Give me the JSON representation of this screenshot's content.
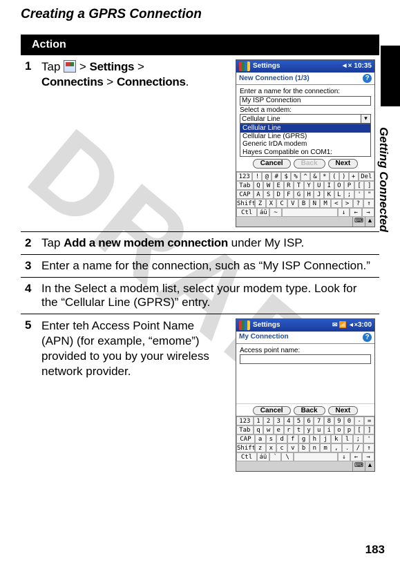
{
  "heading": "Creating a GPRS Connection",
  "action_label": "Action",
  "side_label": "Getting Connected",
  "page_number": "183",
  "watermark": "DRAFT",
  "steps": {
    "s1": {
      "num": "1",
      "pre": "Tap ",
      "settings": "Settings",
      "sep1": " > ",
      "connectins": "Connectins",
      "sep2": " > ",
      "connections": "Connections",
      "post": "."
    },
    "s2": {
      "num": "2",
      "pre": "Tap ",
      "bold": "Add a new modem connection",
      "post": " under My ISP."
    },
    "s3": {
      "num": "3",
      "text": "Enter a name for the connection, such as “My ISP Connection.”"
    },
    "s4": {
      "num": "4",
      "text": "In the Select a modem list, select your modem type. Look for the “Cellular Line (GPRS)” entry."
    },
    "s5": {
      "num": "5",
      "text": "Enter teh Access Point Name (APN) (for example, “emome”) provided to you by your wireless network provider."
    }
  },
  "mock1": {
    "top_title": "Settings",
    "time": "10:35",
    "subtitle": "New Connection (1/3)",
    "lbl_name": "Enter a name for the connection:",
    "val_name": "My ISP Connection",
    "lbl_modem": "Select a modem:",
    "modem_options": {
      "a": "Cellular Line",
      "b": "Cellular Line",
      "c": "Cellular Line (GPRS)",
      "d": "Generic IrDA modem",
      "e": "Hayes Compatible on COM1:"
    },
    "btn_cancel": "Cancel",
    "btn_back": "Back",
    "btn_next": "Next",
    "kbd": {
      "r1": {
        "a": "123",
        "b": "!",
        "c": "@",
        "d": "#",
        "e": "$",
        "f": "%",
        "g": "^",
        "h": "&",
        "i": "*",
        "j": "(",
        "k": ")",
        "l": "+",
        "m": "Del"
      },
      "r2": {
        "a": "Tab",
        "b": "Q",
        "c": "W",
        "d": "E",
        "e": "R",
        "f": "T",
        "g": "Y",
        "h": "U",
        "i": "I",
        "j": "O",
        "k": "P",
        "l": "[",
        "m": "]"
      },
      "r3": {
        "a": "CAP",
        "b": "A",
        "c": "S",
        "d": "D",
        "e": "F",
        "f": "G",
        "g": "H",
        "h": "J",
        "i": "K",
        "j": "L",
        "k": ";",
        "l": "'",
        "m": "\""
      },
      "r4": {
        "a": "Shift",
        "b": "Z",
        "c": "X",
        "d": "C",
        "e": "V",
        "f": "B",
        "g": "N",
        "h": "M",
        "i": "<",
        "j": ">",
        "k": "?",
        "l": "↑"
      },
      "r5": {
        "a": "Ctl",
        "b": "áü",
        "c": "~",
        "d": " ",
        "e": "↓",
        "f": "←",
        "g": "→"
      }
    }
  },
  "mock2": {
    "top_title": "Settings",
    "time": "3:00",
    "subtitle": "My Connection",
    "lbl_apn": "Access point name:",
    "btn_cancel": "Cancel",
    "btn_back": "Back",
    "btn_next": "Next",
    "kbd": {
      "r1": {
        "a": "123",
        "b": "1",
        "c": "2",
        "d": "3",
        "e": "4",
        "f": "5",
        "g": "6",
        "h": "7",
        "i": "8",
        "j": "9",
        "k": "0",
        "l": "-",
        "m": "="
      },
      "r2": {
        "a": "Tab",
        "b": "q",
        "c": "w",
        "d": "e",
        "e": "r",
        "f": "t",
        "g": "y",
        "h": "u",
        "i": "i",
        "j": "o",
        "k": "p",
        "l": "[",
        "m": "]"
      },
      "r3": {
        "a": "CAP",
        "b": "a",
        "c": "s",
        "d": "d",
        "e": "f",
        "f": "g",
        "g": "h",
        "h": "j",
        "i": "k",
        "j": "l",
        "k": ";",
        "l": "'"
      },
      "r4": {
        "a": "Shift",
        "b": "z",
        "c": "x",
        "d": "c",
        "e": "v",
        "f": "b",
        "g": "n",
        "h": "m",
        "i": ",",
        "j": ".",
        "k": "/",
        "l": "↑"
      },
      "r5": {
        "a": "Ctl",
        "b": "áü",
        "c": "`",
        "d": "\\",
        "e": " ",
        "f": "↓",
        "g": "←",
        "h": "→"
      }
    }
  },
  "icons": {
    "speaker": "◄×",
    "help": "?",
    "sip": "⌨",
    "up": "▲",
    "dropdown": "▾"
  }
}
